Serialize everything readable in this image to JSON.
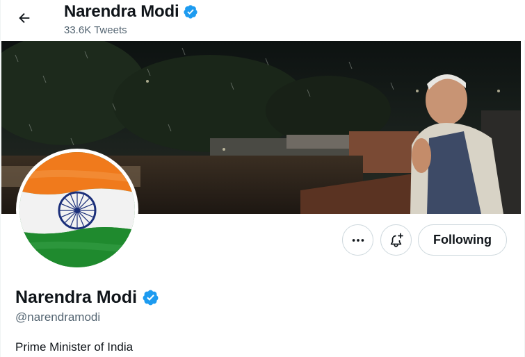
{
  "header": {
    "name": "Narendra Modi",
    "tweet_count": "33.6K Tweets"
  },
  "profile": {
    "name": "Narendra Modi",
    "handle": "@narendramodi",
    "bio": "Prime Minister of India",
    "verified": true
  },
  "actions": {
    "following_label": "Following"
  },
  "icons": {
    "back": "back-arrow-icon",
    "verified": "verified-badge-icon",
    "more": "more-horizontal-icon",
    "notify": "bell-plus-icon"
  },
  "colors": {
    "verified_blue": "#1d9bf0",
    "text_primary": "#0f1419",
    "text_secondary": "#536471",
    "border": "#cfd9de",
    "flag_saffron": "#f07a1c",
    "flag_green": "#1f8a2e",
    "chakra_navy": "#1b2f7a"
  }
}
